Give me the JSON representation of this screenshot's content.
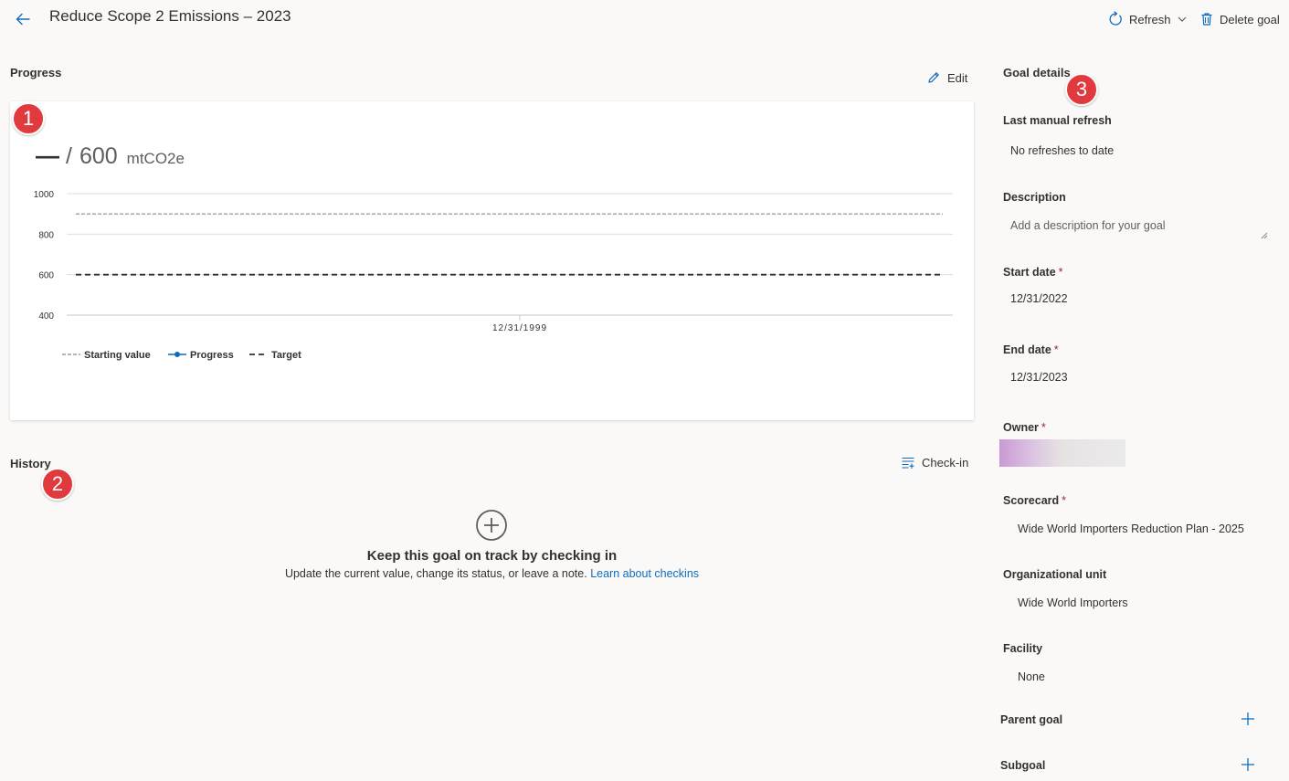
{
  "header": {
    "title": "Reduce Scope 2 Emissions – 2023",
    "refresh_label": "Refresh",
    "delete_label": "Delete goal"
  },
  "progress": {
    "title": "Progress",
    "edit_label": "Edit",
    "current_value": "—",
    "separator": "/",
    "target_value": "600",
    "unit": "mtCO2e"
  },
  "chart_data": {
    "type": "line",
    "y_ticks": [
      1000,
      800,
      600,
      400
    ],
    "ylim": [
      400,
      1000
    ],
    "x_ticks": [
      "12/31/1999"
    ],
    "series": [
      {
        "name": "Starting value",
        "y": 900,
        "style": "dashed",
        "color": "#8a8886"
      },
      {
        "name": "Progress",
        "values": [],
        "style": "solid-marker",
        "color": "#0f6cbd"
      },
      {
        "name": "Target",
        "y": 600,
        "style": "dashed",
        "color": "#323130"
      }
    ],
    "legend_position": "bottom-left",
    "grid": true
  },
  "history": {
    "title": "History",
    "checkin_label": "Check-in",
    "empty_title": "Keep this goal on track by checking in",
    "empty_desc": "Update the current value, change its status, or leave a note.",
    "empty_link": "Learn about checkins"
  },
  "details": {
    "title": "Goal details",
    "last_refresh_label": "Last manual refresh",
    "last_refresh_value": "No refreshes to date",
    "description_label": "Description",
    "description_placeholder": "Add a description for your goal",
    "start_date_label": "Start date",
    "start_date_value": "12/31/2022",
    "end_date_label": "End date",
    "end_date_value": "12/31/2023",
    "owner_label": "Owner",
    "scorecard_label": "Scorecard",
    "scorecard_value": "Wide World Importers Reduction Plan - 2025",
    "org_unit_label": "Organizational unit",
    "org_unit_value": "Wide World Importers",
    "facility_label": "Facility",
    "facility_value": "None",
    "parent_goal_label": "Parent goal",
    "subgoal_label": "Subgoal",
    "required_mark": "*"
  },
  "callouts": [
    "1",
    "2",
    "3"
  ],
  "colors": {
    "accent": "#0f6cbd",
    "callout": "#e03a3e",
    "required": "#a4262c",
    "background": "#faf9f8"
  },
  "icons": {
    "back": "arrow-left-icon",
    "refresh": "refresh-icon",
    "delete": "trash-icon",
    "edit": "pencil-icon",
    "checkin": "list-add-icon",
    "empty": "circle-plus-icon",
    "add": "plus-icon"
  }
}
